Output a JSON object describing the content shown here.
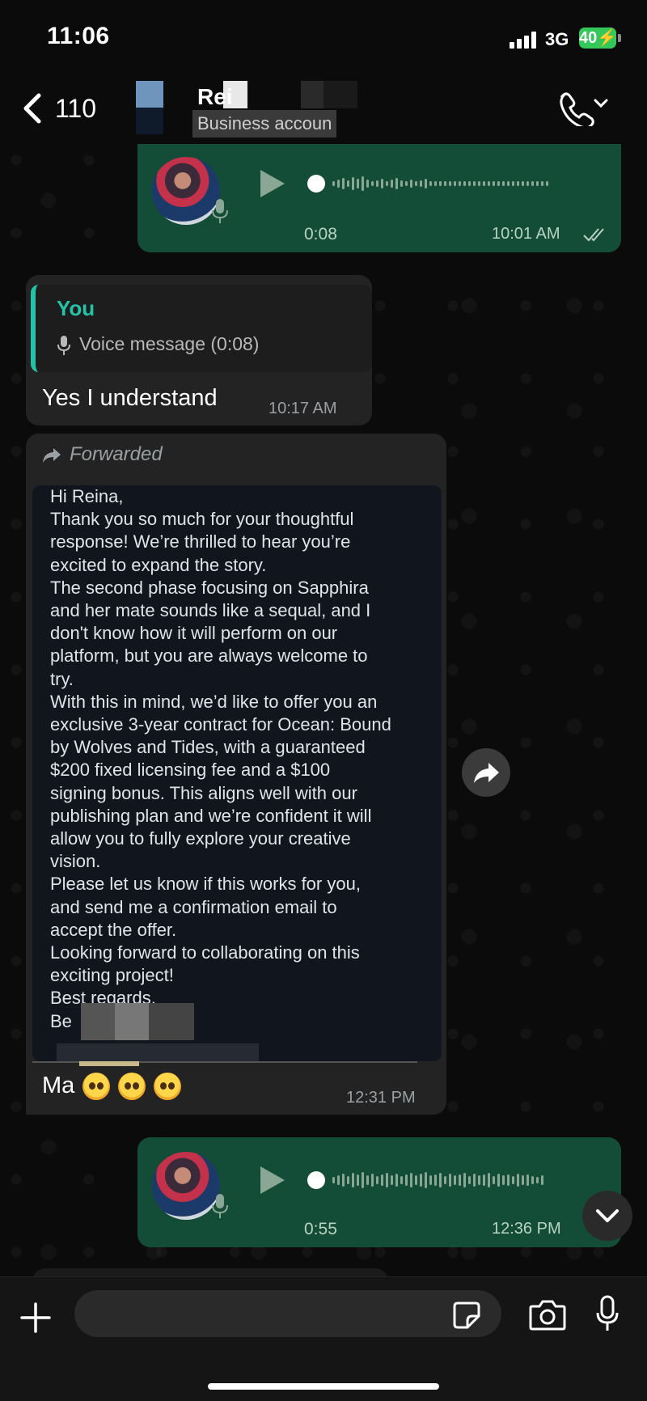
{
  "status_bar": {
    "time": "11:06",
    "network": "3G",
    "battery": "40"
  },
  "header": {
    "back_count": "110",
    "contact_name": "Rei",
    "contact_subtitle": "Business accoun"
  },
  "messages": {
    "voice1": {
      "duration": "0:08",
      "time": "10:01 AM"
    },
    "reply": {
      "quote_author": "You",
      "quote_text": "Voice message (0:08)",
      "text": "Yes I understand",
      "time": "10:17 AM"
    },
    "forwarded": {
      "label": "Forwarded",
      "image_lines": [
        "Hi Reina,",
        "Thank you so much for your thoughtful",
        "response! We’re thrilled to hear you’re",
        "excited to expand the story.",
        "The second phase focusing on Sapphira",
        "and her mate sounds like a sequal, and I",
        "don't know how it will perform on our",
        "platform, but you are always welcome to",
        "try.",
        "With this in mind, we’d like to offer you an",
        "exclusive 3-year contract for Ocean: Bound",
        "by Wolves and Tides, with a guaranteed",
        "$200 fixed licensing fee and a $100",
        "signing bonus. This aligns well with our",
        "publishing plan and we’re confident it will",
        "allow you to fully explore your creative",
        "vision.",
        "Please let us know if this works for you,",
        "and  send me a confirmation email to",
        "accept the offer.",
        "Looking forward to collaborating on this",
        "exciting project!",
        "Best regards,",
        "Be"
      ],
      "caption": "Ma",
      "time": "12:31 PM"
    },
    "voice2": {
      "duration": "0:55",
      "time": "12:36 PM"
    }
  },
  "composer": {
    "placeholder": ""
  },
  "icons": {
    "back": "chevron-left-icon",
    "call": "phone-icon",
    "play": "play-icon",
    "mic": "mic-icon",
    "forward": "forward-arrow-icon",
    "share": "share-icon",
    "scroll": "chevron-down-icon",
    "plus": "plus-icon",
    "sticker": "sticker-icon",
    "camera": "camera-icon"
  },
  "colors": {
    "outgoing_bubble": "#144d37",
    "incoming_bubble": "#232323",
    "quote_accent": "#24c3a8",
    "battery": "#34c759"
  }
}
